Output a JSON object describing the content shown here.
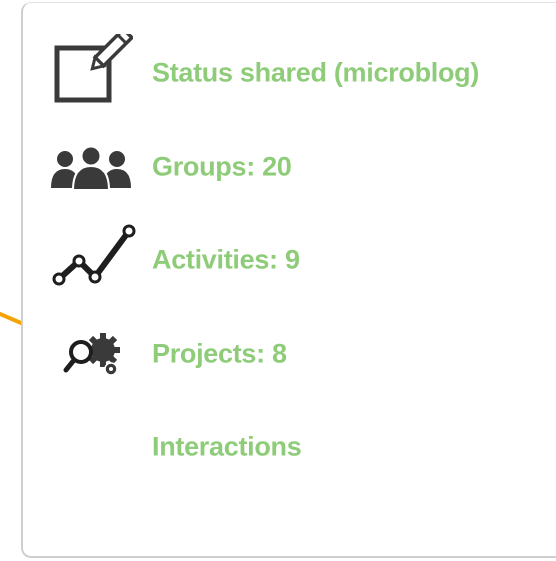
{
  "menu": {
    "items": [
      {
        "id": "status",
        "label": "Status shared (microblog)",
        "icon": "edit-icon"
      },
      {
        "id": "groups",
        "label": "Groups: 20",
        "icon": "people-icon"
      },
      {
        "id": "activities",
        "label": "Activities: 9",
        "icon": "activity-chart-icon"
      },
      {
        "id": "projects",
        "label": "Projects: 8",
        "icon": "project-gear-icon"
      },
      {
        "id": "interactions",
        "label": "Interactions",
        "icon": ""
      }
    ]
  },
  "colors": {
    "label": "#8fcc7a",
    "icon": "#3a3a3a",
    "arrow": "#f5a300",
    "border": "#cfcfcf"
  }
}
